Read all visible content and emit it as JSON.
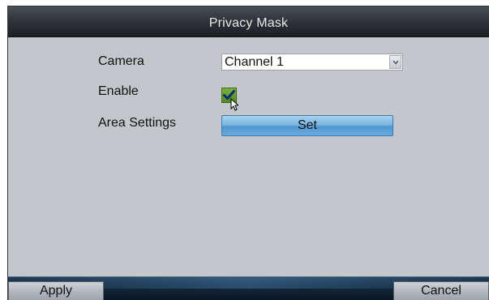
{
  "dialog": {
    "title": "Privacy Mask"
  },
  "form": {
    "camera": {
      "label": "Camera",
      "selected": "Channel 1",
      "dropdown_icon": "chevron-down-icon"
    },
    "enable": {
      "label": "Enable",
      "checked": true,
      "check_icon": "checkmark-icon"
    },
    "area_settings": {
      "label": "Area Settings",
      "button_label": "Set"
    }
  },
  "footer": {
    "apply_label": "Apply",
    "cancel_label": "Cancel"
  },
  "colors": {
    "panel_bg": "#c3c7cc",
    "title_bar": "#2f3338",
    "set_button": "#7ab6e2",
    "checkbox_green": "#5d9a2c",
    "footer_bar": "#14263a"
  }
}
